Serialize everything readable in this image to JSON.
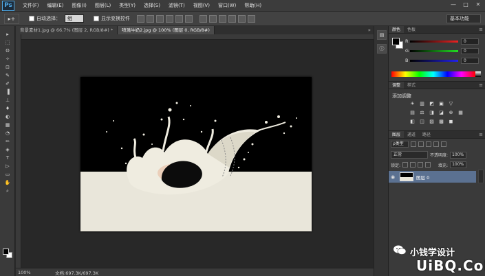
{
  "app": {
    "logo": "Ps"
  },
  "menu": [
    "文件(F)",
    "编辑(E)",
    "图像(I)",
    "图层(L)",
    "类型(Y)",
    "选择(S)",
    "滤镜(T)",
    "视图(V)",
    "窗口(W)",
    "帮助(H)"
  ],
  "window_controls": [
    "—",
    "□",
    "✕"
  ],
  "options": {
    "tool_glyph": "▸+",
    "auto_select_label": "自动选择：",
    "auto_select_value": "组",
    "show_transform_label": "显示变换控件",
    "workspace": "基本功能"
  },
  "tabs": [
    {
      "label": "背景素材1.jpg @ 66.7% (图层 2, RGB/8#) *",
      "active": false
    },
    {
      "label": "喷溅牛奶2.jpg @ 100% (图层 0, RGB/8#)",
      "active": true
    }
  ],
  "tab_more": "»",
  "tools": [
    "▸",
    "⬚",
    "ʘ",
    "✧",
    "⊡",
    "✎",
    "✐",
    "▐",
    "⊥",
    "♦",
    "◐",
    "▦",
    "◔",
    "✏",
    "◈",
    "T",
    "▷",
    "▭",
    "✋",
    "⌕"
  ],
  "status": {
    "zoom": "100%",
    "doc": "文档:697.3K/697.3K"
  },
  "color_panel": {
    "tabs": [
      "颜色",
      "色板"
    ],
    "sliders": [
      {
        "letter": "R",
        "value": "0",
        "color": "#d22"
      },
      {
        "letter": "G",
        "value": "0",
        "color": "#2b2"
      },
      {
        "letter": "B",
        "value": "0",
        "color": "#22d"
      }
    ]
  },
  "adjust_panel": {
    "tabs": [
      "调整",
      "样式"
    ],
    "title": "添加调整",
    "rows": [
      [
        "☀",
        "▥",
        "◩",
        "▣",
        "▽"
      ],
      [
        "▤",
        "⚖",
        "◨",
        "◪",
        "⊕",
        "▦"
      ],
      [
        "◧",
        "◫",
        "▨",
        "▩",
        "◼"
      ]
    ]
  },
  "layers_panel": {
    "tabs": [
      "图层",
      "通道",
      "路径"
    ],
    "kind": "ρ类型",
    "blend_mode": "正常",
    "opacity_label": "不透明度:",
    "opacity": "100%",
    "lock_label": "锁定:",
    "fill_label": "填充:",
    "fill": "100%",
    "layer": {
      "name": "图层 0"
    }
  },
  "watermark": {
    "cn": "小钱学设计",
    "en": "UiBQ.CoM"
  }
}
